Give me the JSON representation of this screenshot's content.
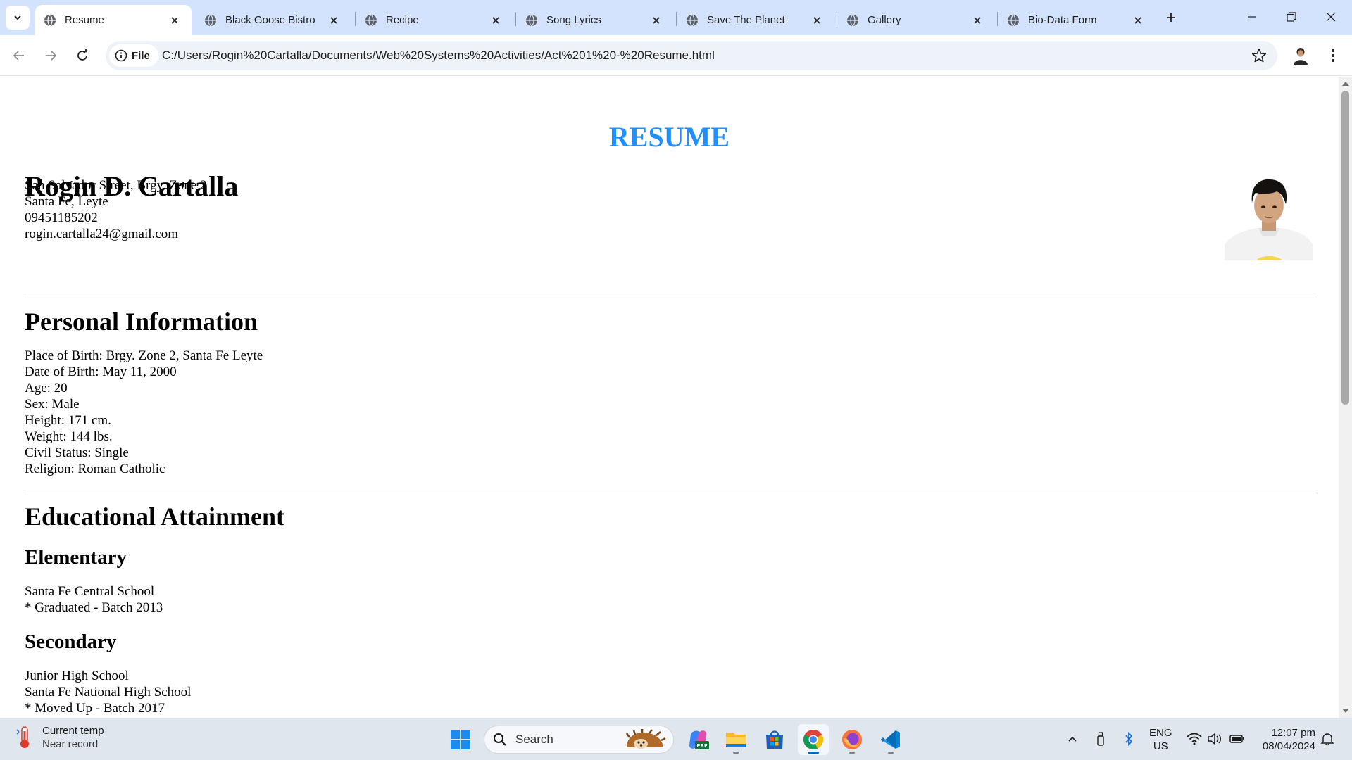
{
  "browser": {
    "tabs": [
      {
        "title": "Resume",
        "active": true
      },
      {
        "title": "Black Goose Bistro",
        "active": false
      },
      {
        "title": "Recipe",
        "active": false
      },
      {
        "title": "Song Lyrics",
        "active": false
      },
      {
        "title": "Save The Planet",
        "active": false
      },
      {
        "title": "Gallery",
        "active": false
      },
      {
        "title": "Bio-Data Form",
        "active": false
      }
    ],
    "address_chip": "File",
    "url": "C:/Users/Rogin%20Cartalla/Documents/Web%20Systems%20Activities/Act%201%20-%20Resume.html",
    "icons": [
      "tab-search-icon",
      "globe-icon",
      "close-icon",
      "plus-icon",
      "minimize-icon",
      "restore-icon",
      "back-arrow-icon",
      "forward-arrow-icon",
      "reload-icon",
      "info-icon",
      "star-icon",
      "profile-avatar-icon",
      "kebab-menu-icon"
    ]
  },
  "page": {
    "heading": "RESUME",
    "heading_color": "#1e90ff",
    "name": "Rogin D. Cartalla",
    "contact": [
      "San Salvador Street, Brgy. Zone 2",
      "Santa Fe, Leyte",
      "09451185202",
      "rogin.cartalla24@gmail.com"
    ],
    "personal_heading": "Personal Information",
    "personal": [
      "Place of Birth: Brgy. Zone 2, Santa Fe Leyte",
      "Date of Birth: May 11, 2000",
      "Age: 20",
      "Sex: Male",
      "Height: 171 cm.",
      "Weight: 144 lbs.",
      "Civil Status: Single",
      "Religion: Roman Catholic"
    ],
    "education_heading": "Educational Attainment",
    "elementary": {
      "heading": "Elementary",
      "lines": [
        "Santa Fe Central School",
        "* Graduated - Batch 2013"
      ]
    },
    "secondary": {
      "heading": "Secondary",
      "lines": [
        "Junior High School",
        "Santa Fe National High School",
        "* Moved Up - Batch 2017"
      ]
    }
  },
  "taskbar": {
    "weather_title": "Current temp",
    "weather_sub": "Near record",
    "search_placeholder": "Search",
    "lang_top": "ENG",
    "lang_bottom": "US",
    "time": "12:07 pm",
    "date": "08/04/2024",
    "accent": "#0a64c2"
  }
}
